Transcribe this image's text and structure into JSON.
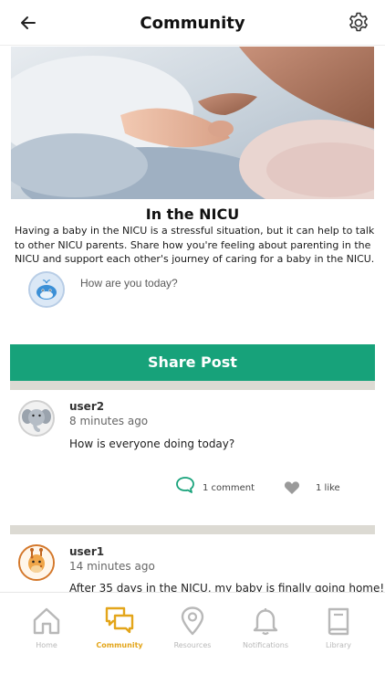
{
  "header": {
    "title": "Community",
    "back_icon": "back-arrow-icon",
    "settings_icon": "gear-icon"
  },
  "intro": {
    "title": "In the NICU",
    "text": "Having a baby in the NICU is a stressful situation, but it can help to talk to other NICU parents. Share how you're feeling about parenting in the NICU and support each other's journey of caring for a baby in the NICU."
  },
  "composer": {
    "placeholder": "How are you today?",
    "avatar": "whale-avatar"
  },
  "share_button": "Share Post",
  "posts": [
    {
      "user": "user2",
      "time": "8 minutes ago",
      "body": "How is everyone doing today?",
      "comments": "1 comment",
      "likes": "1 like",
      "avatar": "elephant-avatar"
    },
    {
      "user": "user1",
      "time": "14 minutes ago",
      "body": "After 35 days in the NICU, my baby is finally going home!",
      "avatar": "giraffe-avatar"
    }
  ],
  "tabs": [
    {
      "label": "Home",
      "icon": "home-icon"
    },
    {
      "label": "Community",
      "icon": "chat-bubbles-icon"
    },
    {
      "label": "Resources",
      "icon": "location-pin-icon"
    },
    {
      "label": "Notifications",
      "icon": "bell-icon"
    },
    {
      "label": "Library",
      "icon": "book-icon"
    }
  ],
  "colors": {
    "accent": "#17a27a",
    "active_tab": "#e3a51a",
    "inactive_tab": "#b8b8b8",
    "divider": "#dcdad3"
  }
}
